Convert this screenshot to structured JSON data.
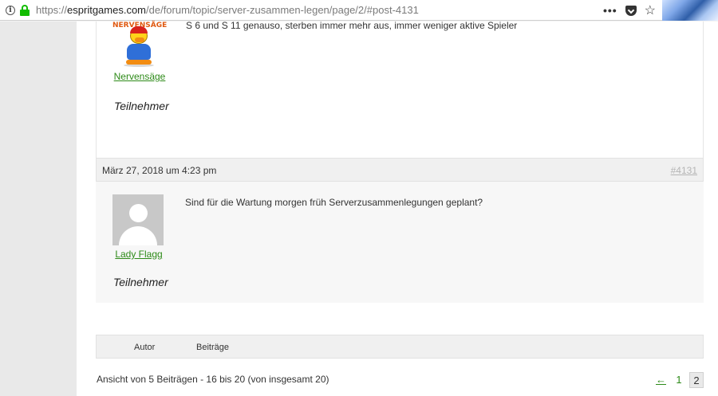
{
  "browser": {
    "url_prefix": "https://",
    "url_host": "espritgames.com",
    "url_path": "/de/forum/topic/server-zusammen-legen/page/2/#post-4131",
    "more_label": "•••",
    "star_label": "☆",
    "info_label": "i"
  },
  "posts": [
    {
      "author_banner": "NERVENSÄGE",
      "author_name": "Nervensäge",
      "author_role": "Teilnehmer",
      "text": "S 6 und S 11 genauso, sterben immer mehr aus, immer weniger aktive Spieler"
    },
    {
      "date": "März 27, 2018 um 4:23 pm",
      "permalink": "#4131",
      "author_name": "Lady Flagg",
      "author_role": "Teilnehmer",
      "text": "Sind für die Wartung morgen früh Serverzusammenlegungen geplant?"
    }
  ],
  "footer": {
    "col_author": "Autor",
    "col_posts": "Beiträge"
  },
  "pagination": {
    "info": "Ansicht von 5 Beiträgen - 16 bis 20 (von insgesamt 20)",
    "prev": "←",
    "pages": [
      "1",
      "2"
    ],
    "current": "2"
  }
}
